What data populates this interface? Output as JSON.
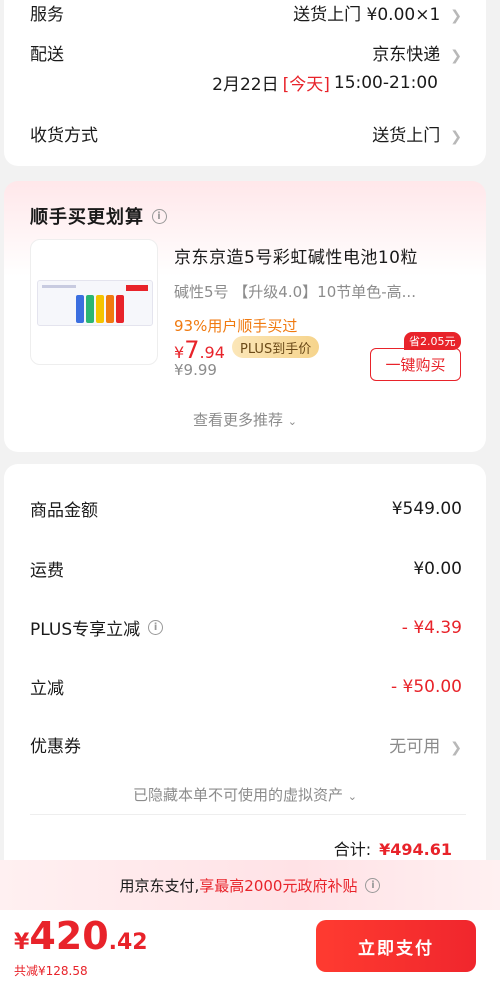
{
  "delivery": {
    "service_label": "服务",
    "service_value": "送货上门 ¥0.00×1",
    "shipping_label": "配送",
    "shipping_value": "京东快递",
    "date_prefix": "2月22日",
    "date_tag": "[今天]",
    "time_range": "15:00-21:00",
    "receive_label": "收货方式",
    "receive_value": "送货上门"
  },
  "recommend": {
    "title": "顺手买更划算",
    "product_name": "京东京造5号彩虹碱性电池10粒",
    "spec": "碱性5号 【升级4.0】10节单色-高...",
    "buyers": "93%用户顺手买过",
    "price_symbol": "¥",
    "price_int": "7",
    "price_dec": ".94",
    "plus_label": "PLUS到手价",
    "original_price": "¥9.99",
    "save_badge": "省2.05元",
    "buy_button": "一键购买",
    "more": "查看更多推荐"
  },
  "amounts": {
    "rows": [
      {
        "label": "商品金额",
        "value": "¥549.00"
      },
      {
        "label": "运费",
        "value": "¥0.00"
      },
      {
        "label": "PLUS专享立减",
        "value": "- ¥4.39"
      },
      {
        "label": "立减",
        "value": "- ¥50.00"
      },
      {
        "label": "优惠券",
        "value": "无可用"
      }
    ],
    "hidden_assets": "已隐藏本单不可使用的虚拟资产",
    "total_label": "合计:",
    "total_value": "¥494.61"
  },
  "bottom": {
    "subsidy_prefix": "用京东支付,",
    "subsidy_highlight": "享最高2000元政府补贴",
    "currency": "¥",
    "pay_int": "420",
    "pay_dec": ".42",
    "saved": "共减¥128.58",
    "pay_button": "立即支付"
  },
  "colors": {
    "accent": "#e8232a",
    "orange": "#f07a10",
    "plus_gold": "#f6d48c"
  }
}
